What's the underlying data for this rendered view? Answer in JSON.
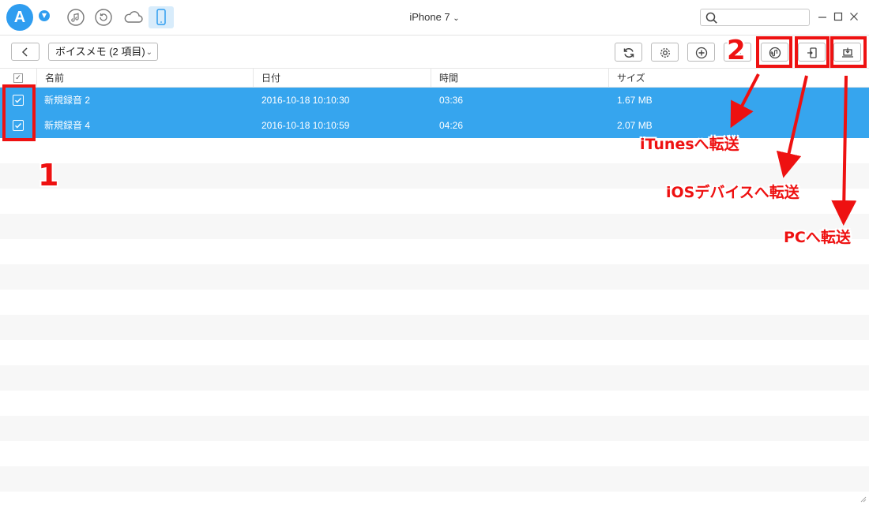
{
  "app": {
    "logo_letter": "A",
    "device_title": "iPhone 7",
    "title_chevron": "⌄",
    "top_icons": [
      "music-icon",
      "restore-icon",
      "cloud-icon",
      "phone-icon"
    ],
    "search_placeholder": "",
    "window_controls": [
      "minimize-icon",
      "maximize-icon",
      "close-icon"
    ]
  },
  "toolbar": {
    "category_label": "ボイスメモ (2 項目)",
    "category_chevron": "⌄",
    "buttons": [
      "refresh-icon",
      "settings-icon",
      "add-icon",
      "delete-icon",
      "to-itunes-icon",
      "to-device-icon",
      "to-pc-icon"
    ]
  },
  "table": {
    "columns": [
      "名前",
      "日付",
      "時間",
      "サイズ"
    ],
    "header_check": "✓",
    "rows": [
      {
        "name": "新規録音 2",
        "date": "2016-10-18 10:10:30",
        "duration": "03:36",
        "size": "1.67 MB",
        "selected": true
      },
      {
        "name": "新規録音 4",
        "date": "2016-10-18 10:10:59",
        "duration": "04:26",
        "size": "2.07 MB",
        "selected": true
      }
    ]
  },
  "annotations": {
    "step1": "1",
    "step2": "2",
    "to_itunes": "iTunesへ転送",
    "to_ios": "iOSデバイスへ転送",
    "to_pc": "PCへ転送"
  },
  "colors": {
    "accent": "#2f9df0",
    "selection": "#36a5ee",
    "annotation": "#ee1111"
  }
}
